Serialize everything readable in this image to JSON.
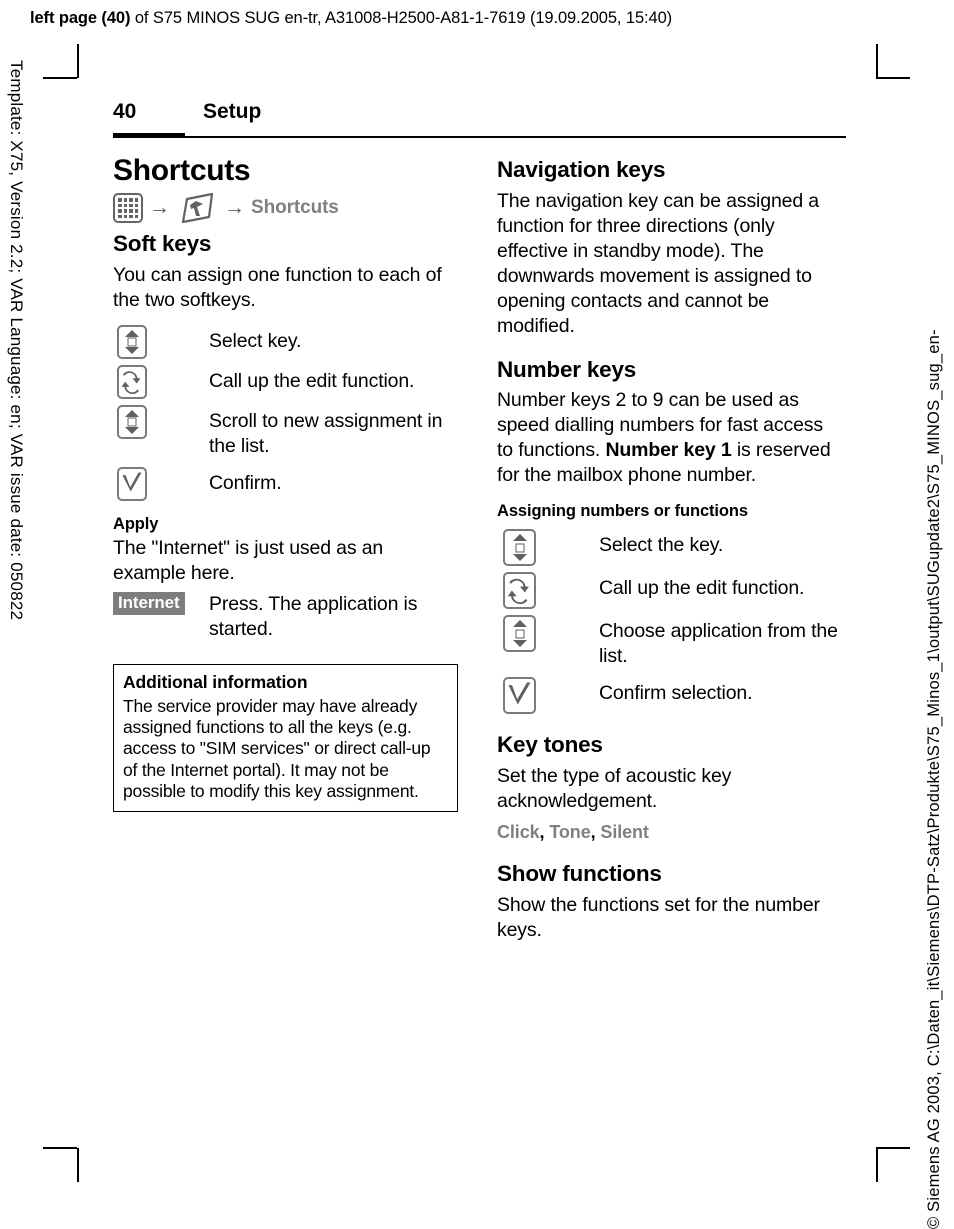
{
  "proof_header": {
    "bold_prefix": "left page (40)",
    "rest": " of S75 MINOS SUG en-tr, A31008-H2500-A81-1-7619 (19.09.2005, 15:40)"
  },
  "side_text": {
    "left": "Template: X75, Version 2.2; VAR Language: en; VAR issue date: 050822",
    "right": "© Siemens AG 2003, C:\\Daten_it\\Siemens\\DTP-Satz\\Produkte\\S75_Minos_1\\output\\SUGupdate2\\S75_MINOS_sug_en-"
  },
  "running_head": {
    "page_number": "40",
    "chapter": "Setup"
  },
  "left_column": {
    "title": "Shortcuts",
    "breadcrumb": {
      "menu_icon": "menu-grid-icon",
      "arrow1": "→",
      "settings_icon": "settings-wrench-icon",
      "arrow2": "→",
      "label": "Shortcuts"
    },
    "soft_keys": {
      "heading": "Soft keys",
      "intro": "You can assign one function to each of the two softkeys.",
      "steps": [
        {
          "icon": "nav-updown-key-icon",
          "text": "Select key."
        },
        {
          "icon": "edit-refresh-key-icon",
          "text": "Call up the edit function."
        },
        {
          "icon": "nav-updown-key-icon",
          "text": "Scroll to new assignment in the list."
        },
        {
          "icon": "confirm-check-key-icon",
          "text": "Confirm."
        }
      ]
    },
    "apply": {
      "subheading": "Apply",
      "text": "The \"Internet\" is just used as an example here.",
      "badge": "Internet",
      "badge_text": "Press. The application is started."
    },
    "info_box": {
      "title": "Additional information",
      "body": "The service provider may have already assigned functions to all the keys (e.g. access to \"SIM services\" or direct call-up of the Internet portal). It may not be possible to modify this key assignment."
    }
  },
  "right_column": {
    "navigation_keys": {
      "heading": "Navigation keys",
      "body": "The navigation key can be assigned a function for three directions (only effective in standby mode). The downwards movement is assigned to opening contacts and cannot be modified."
    },
    "number_keys": {
      "heading": "Number keys",
      "body_part1": "Number keys 2 to 9 can be used as speed dialling numbers for fast access to functions. ",
      "body_bold": "Number key 1",
      "body_part2": " is reserved for the mailbox phone number.",
      "subheading": "Assigning numbers or functions",
      "steps": [
        {
          "icon": "nav-updown-key-icon",
          "text": "Select the key."
        },
        {
          "icon": "edit-refresh-key-icon",
          "text": "Call up the edit function."
        },
        {
          "icon": "nav-updown-key-icon",
          "text": "Choose application from the list."
        },
        {
          "icon": "confirm-check-key-icon",
          "text": "Confirm selection."
        }
      ]
    },
    "key_tones": {
      "heading": "Key tones",
      "body": "Set the type of acoustic key acknowledgement.",
      "options": [
        "Click",
        "Tone",
        "Silent"
      ]
    },
    "show_functions": {
      "heading": "Show functions",
      "body": "Show the functions set for the number keys."
    }
  },
  "colors": {
    "icon_grey": "#636363",
    "key_outline_grey": "#7a7a7a",
    "value_grey": "#808080",
    "badge_bg": "#7d7d7d"
  }
}
